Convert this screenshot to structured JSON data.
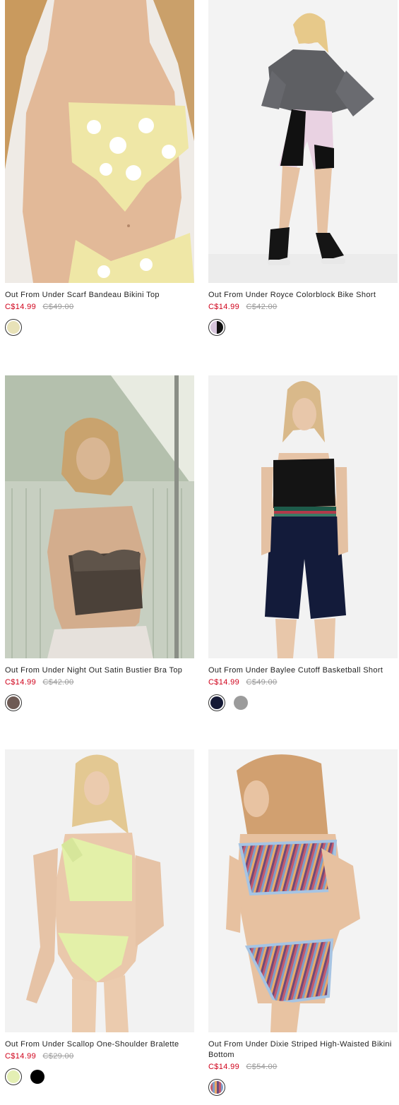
{
  "products": [
    {
      "title": "Out From Under Scarf Bandeau Bikini Top",
      "sale_price": "C$14.99",
      "original_price": "C$49.00",
      "image_alt": "model in yellow polka dot bandeau bikini top",
      "swatches": [
        {
          "name": "yellow-polka-dot",
          "color": "#e8e2b8"
        }
      ]
    },
    {
      "title": "Out From Under Royce Colorblock Bike Short",
      "sale_price": "C$14.99",
      "original_price": "C$42.00",
      "image_alt": "model in grey sweatshirt and pink colorblock bike shorts",
      "swatches": [
        {
          "name": "lilac-black",
          "color": "#d7c6dc"
        }
      ]
    },
    {
      "title": "Out From Under Night Out Satin Bustier Bra Top",
      "sale_price": "C$14.99",
      "original_price": "C$42.00",
      "image_alt": "model in brown satin bustier bra top",
      "swatches": [
        {
          "name": "brown",
          "color": "#6e5a54"
        }
      ]
    },
    {
      "title": "Out From Under Baylee Cutoff Basketball Short",
      "sale_price": "C$14.99",
      "original_price": "C$49.00",
      "image_alt": "model in black camisole and navy basketball shorts",
      "swatches": [
        {
          "name": "navy",
          "color": "#151a36"
        },
        {
          "name": "grey",
          "color": "#9b9b9b"
        }
      ]
    },
    {
      "title": "Out From Under Scallop One-Shoulder Bralette",
      "sale_price": "C$14.99",
      "original_price": "C$29.00",
      "image_alt": "model in lime green scallop one-shoulder bralette",
      "swatches": [
        {
          "name": "lime",
          "color": "#e4efb4"
        },
        {
          "name": "black",
          "color": "#000000"
        }
      ]
    },
    {
      "title": "Out From Under Dixie Striped High-Waisted Bikini Bottom",
      "sale_price": "C$14.99",
      "original_price": "C$54.00",
      "image_alt": "model in striped high-waisted bikini",
      "swatches": [
        {
          "name": "multi-stripe",
          "color": "#c35a6e"
        }
      ]
    }
  ],
  "colors": {
    "sale": "#d0021b",
    "original": "#9a9a9a"
  }
}
